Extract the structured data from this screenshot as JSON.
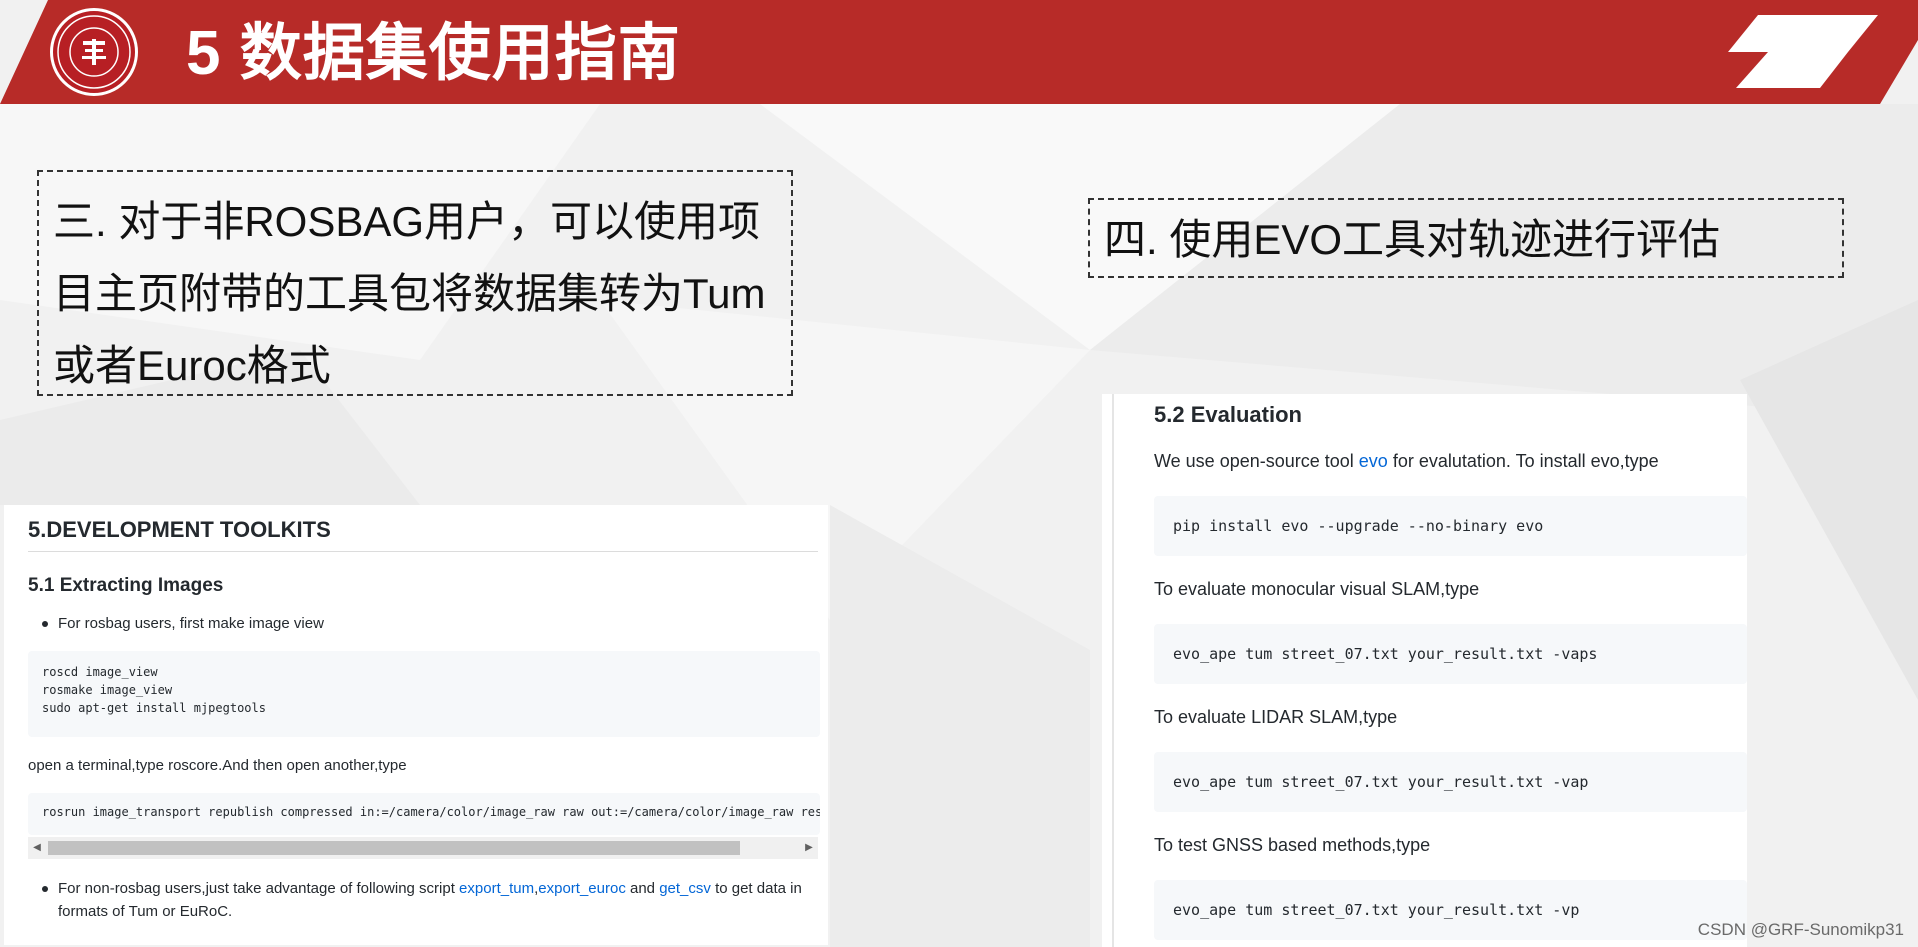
{
  "slide": {
    "title": "5 数据集使用指南",
    "colors": {
      "header_red": "#b72b28",
      "accent_white": "#ffffff"
    },
    "logo_icon": "university-seal-icon"
  },
  "box_left": {
    "text": "三. 对于非ROSBAG用户，可以使用项目主页附带的工具包将数据集转为Tum或者Euroc格式"
  },
  "box_right": {
    "text": "四. 使用EVO工具对轨迹进行评估"
  },
  "doc_left": {
    "heading": "5.DEVELOPMENT TOOLKITS",
    "subheading": "5.1 Extracting Images",
    "bullet1": "For rosbag users, first make image view",
    "code1": [
      "roscd image_view",
      "rosmake image_view",
      "sudo apt-get install mjpegtools"
    ],
    "para1": "open a terminal,type roscore.And then open another,type",
    "code2": "rosrun image_transport republish compressed in:=/camera/color/image_raw raw out:=/camera/color/image_raw resp",
    "bullet2_pre": "For non-rosbag users,just take advantage of following script ",
    "bullet2_link1": "export_tum",
    "bullet2_sep": ",",
    "bullet2_link2": "export_euroc",
    "bullet2_and": " and ",
    "bullet2_link3": "get_csv",
    "bullet2_post": " to get data in formats of Tum or EuRoC."
  },
  "doc_right": {
    "heading": "5.2 Evaluation",
    "intro_pre": "We use open-source tool ",
    "intro_link": "evo",
    "intro_post": " for evalutation. To install evo,type",
    "code1": "pip install evo --upgrade --no-binary evo",
    "para1": "To evaluate monocular visual SLAM,type",
    "code2": "evo_ape tum street_07.txt your_result.txt -vaps",
    "para2": "To evaluate LIDAR SLAM,type",
    "code3": "evo_ape tum street_07.txt your_result.txt -vap",
    "para3": "To test GNSS based methods,type",
    "code4": "evo_ape tum street_07.txt your_result.txt -vp"
  },
  "watermark": "CSDN @GRF-Sunomikp31"
}
